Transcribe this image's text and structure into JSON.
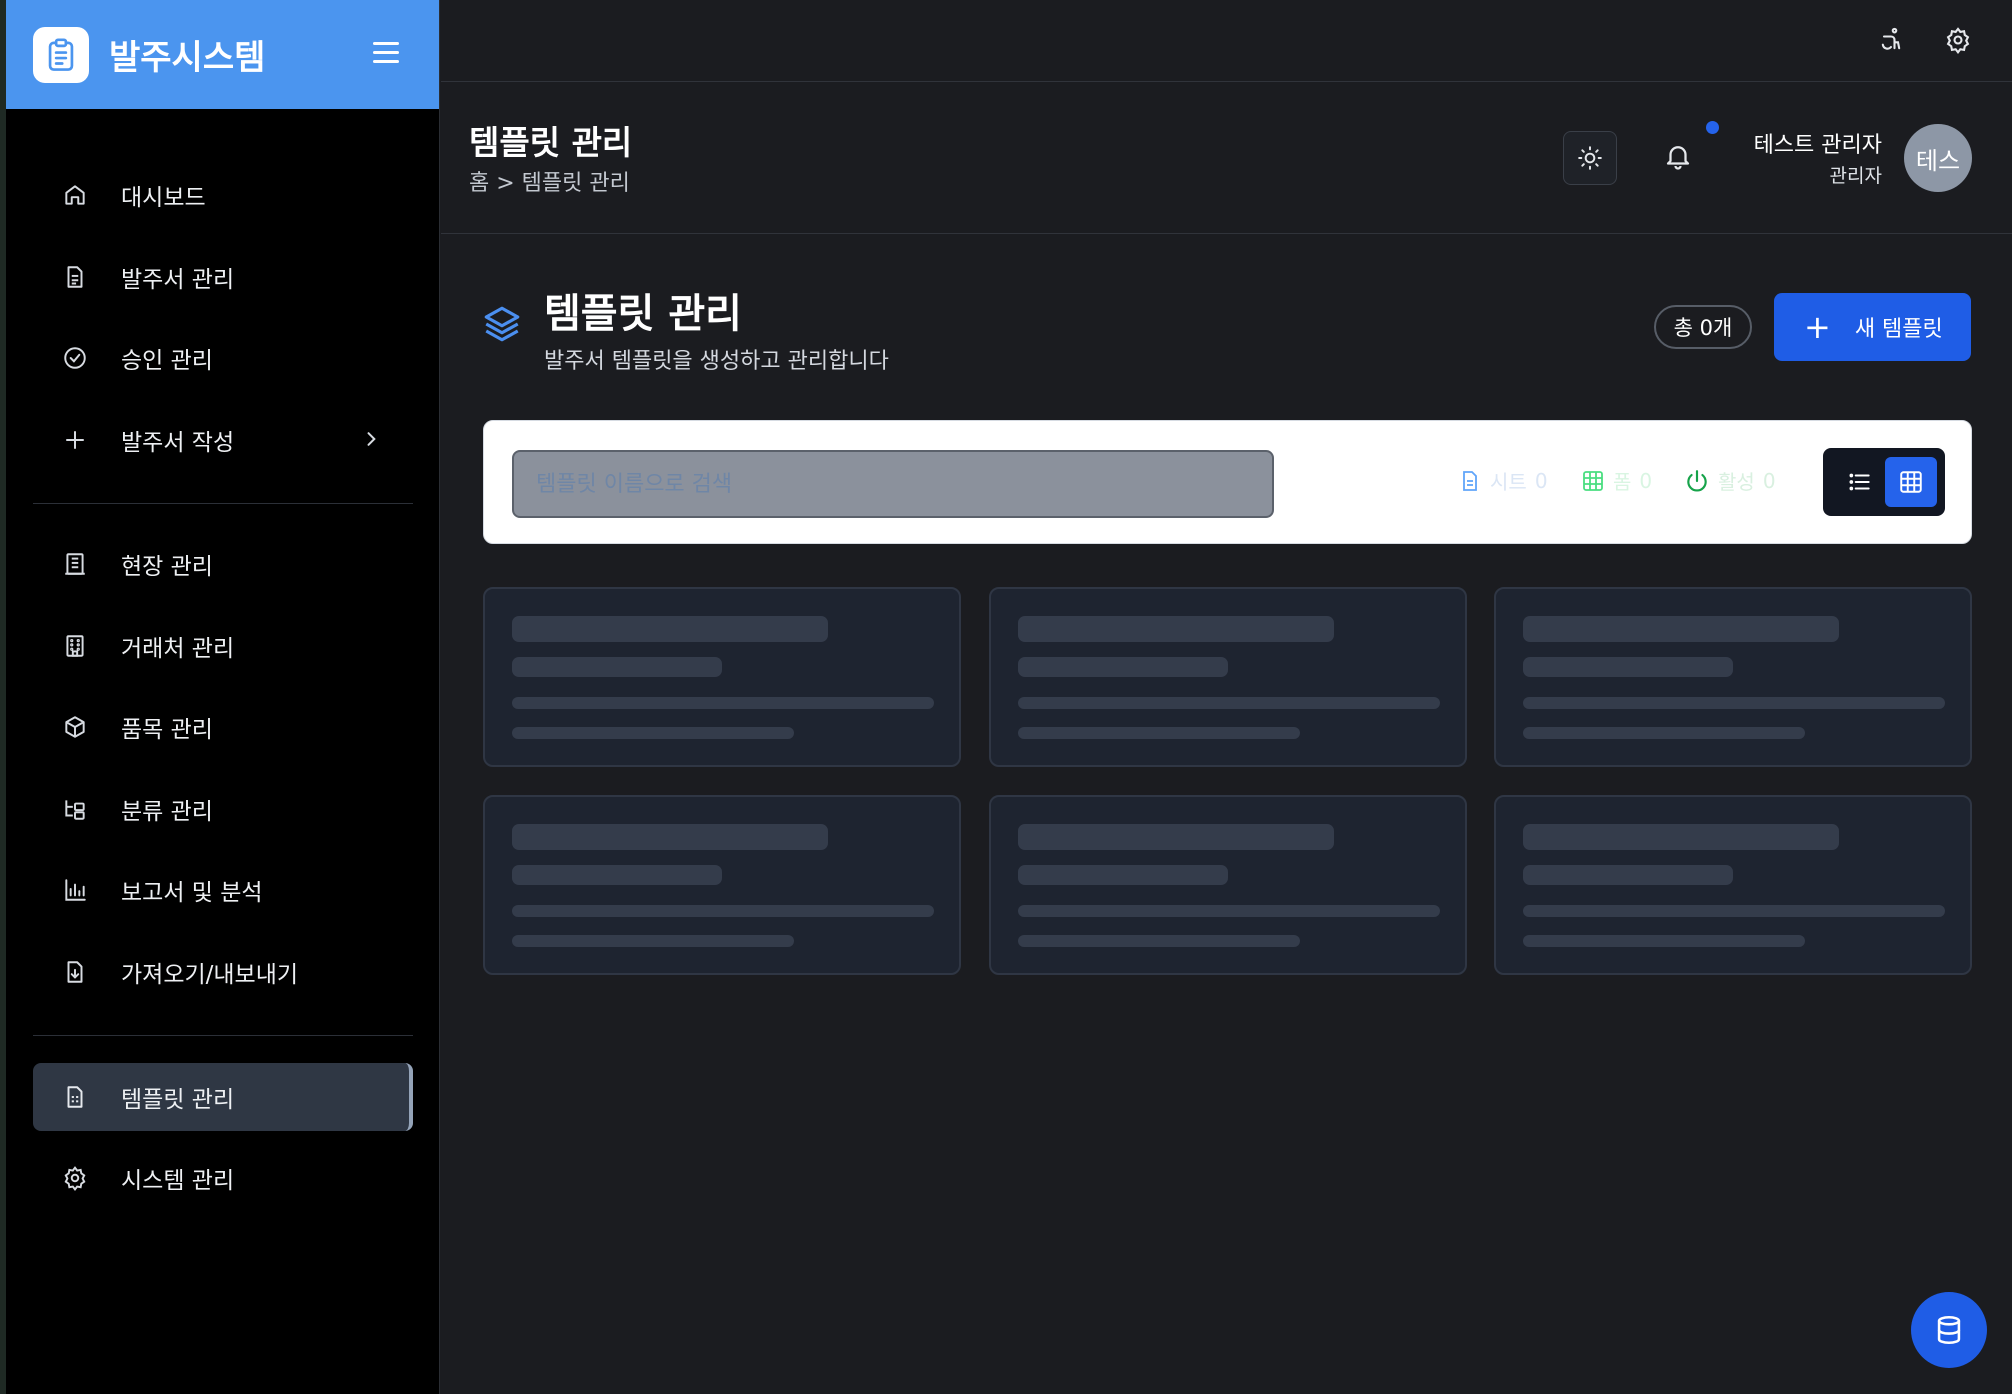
{
  "app": {
    "brand_title": "발주시스템",
    "accent": "#4b95ef",
    "primary": "#1f5de6"
  },
  "sidebar": {
    "items": [
      {
        "label": "대시보드",
        "icon": "home-icon"
      },
      {
        "label": "발주서 관리",
        "icon": "document-icon"
      },
      {
        "label": "승인 관리",
        "icon": "check-circle-icon"
      },
      {
        "label": "발주서 작성",
        "icon": "plus-icon"
      },
      {
        "label": "현장 관리",
        "icon": "building-icon"
      },
      {
        "label": "거래처 관리",
        "icon": "office-icon"
      },
      {
        "label": "품목 관리",
        "icon": "package-icon"
      },
      {
        "label": "분류 관리",
        "icon": "tree-icon"
      },
      {
        "label": "보고서 및 분석",
        "icon": "bar-chart-icon"
      },
      {
        "label": "가져오기/내보내기",
        "icon": "file-download-icon"
      },
      {
        "label": "템플릿 관리",
        "icon": "spreadsheet-icon",
        "active": true
      },
      {
        "label": "시스템 관리",
        "icon": "gear-icon"
      }
    ]
  },
  "header": {
    "title": "템플릿 관리",
    "breadcrumb": "홈 > 템플릿 관리",
    "user_name": "테스트 관리자",
    "user_role": "관리자",
    "avatar_text": "테스"
  },
  "main": {
    "title": "템플릿 관리",
    "subtitle": "발주서 템플릿을 생성하고 관리합니다",
    "count_label": "총 0개",
    "new_button_label": "새 템플릿",
    "search_placeholder": "템플릿 이름으로 검색",
    "stats": [
      {
        "label": "시트",
        "value": "0",
        "color": "#60a5fa",
        "icon": "file-sheet-icon"
      },
      {
        "label": "폼",
        "value": "0",
        "color": "#4ade80",
        "icon": "grid-table-icon"
      },
      {
        "label": "활성",
        "value": "0",
        "color": "#22c55e",
        "icon": "power-icon"
      }
    ]
  }
}
